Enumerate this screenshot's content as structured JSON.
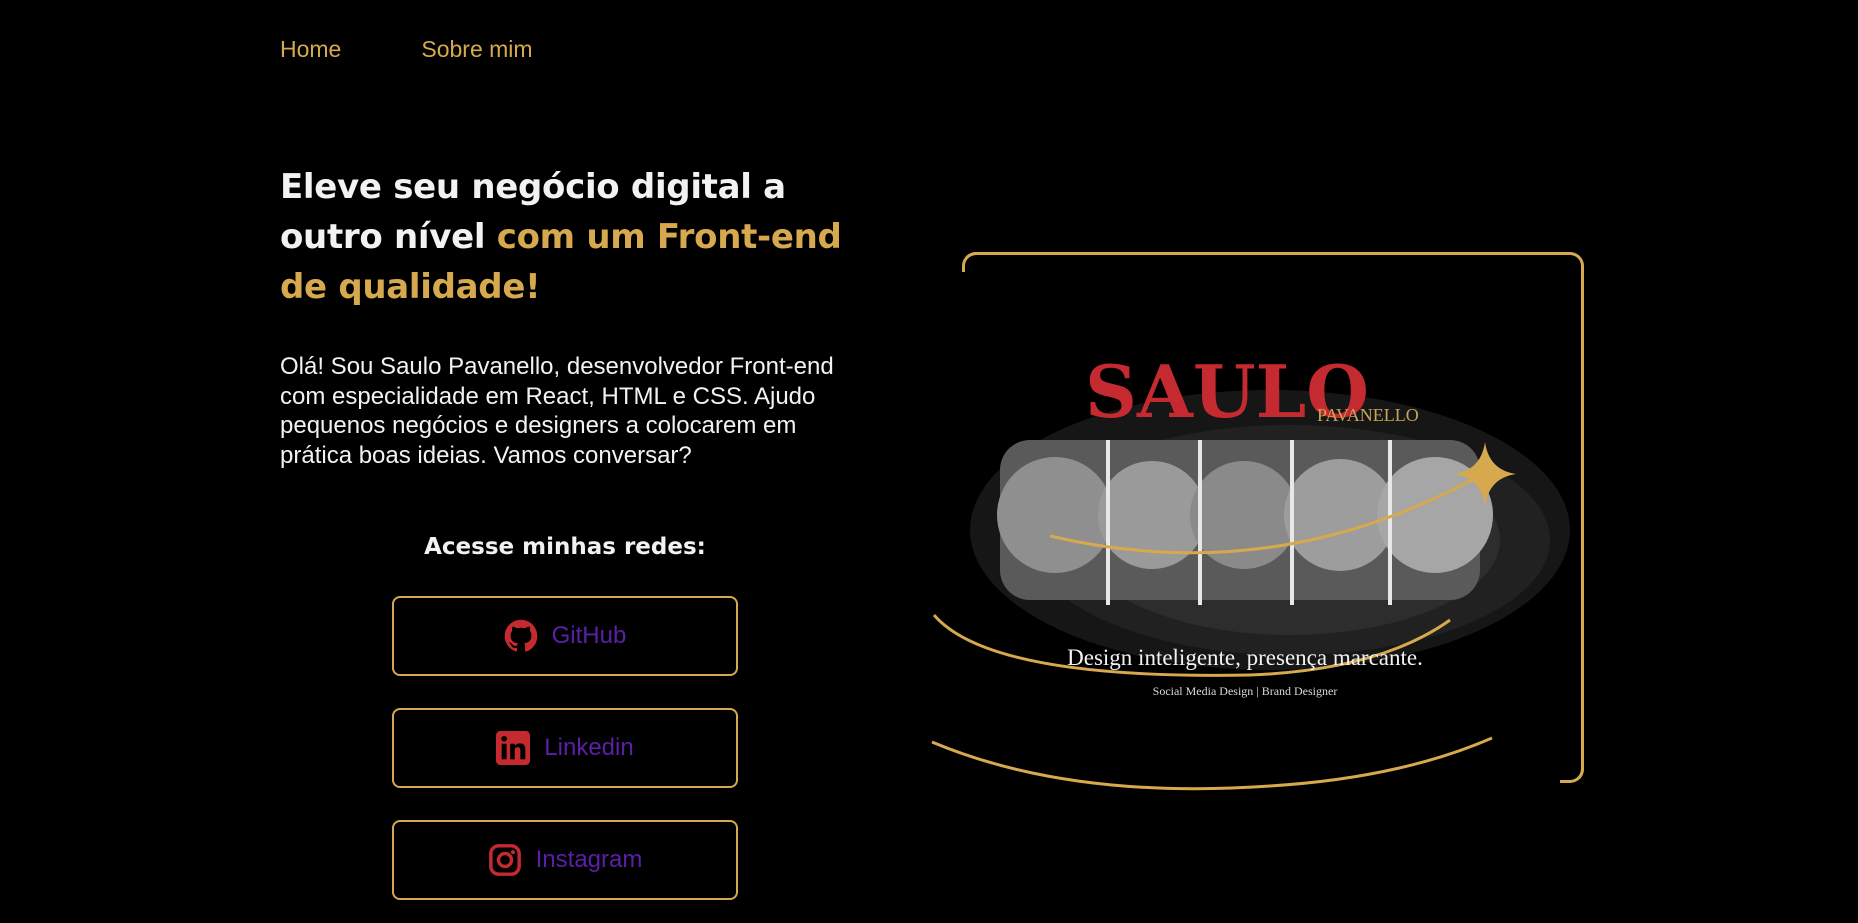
{
  "nav": {
    "items": [
      {
        "label": "Home"
      },
      {
        "label": "Sobre mim"
      }
    ]
  },
  "hero": {
    "headline_white": "Eleve seu negócio digital a outro nível",
    "headline_accent": "com um Front-end de qualidade!",
    "bio": "Olá! Sou Saulo Pavanello, desenvolvedor Front-end com especialidade em React, HTML e CSS. Ajudo pequenos negócios e designers a colocarem em prática boas ideias. Vamos conversar?"
  },
  "social": {
    "title": "Acesse minhas redes:",
    "links": [
      {
        "label": "GitHub",
        "icon": "github-icon"
      },
      {
        "label": "Linkedin",
        "icon": "linkedin-icon"
      },
      {
        "label": "Instagram",
        "icon": "instagram-icon"
      }
    ]
  },
  "art": {
    "brand_main": "SAULO",
    "brand_sub": "PAVANELLO",
    "tagline": "Design inteligente, presença marcante.",
    "subtitle": "Social Media Design | Brand Designer"
  },
  "colors": {
    "accent_gold": "#d6a94e",
    "link_purple": "#5b1fa8",
    "icon_red": "#c62a31",
    "background": "#000000"
  }
}
